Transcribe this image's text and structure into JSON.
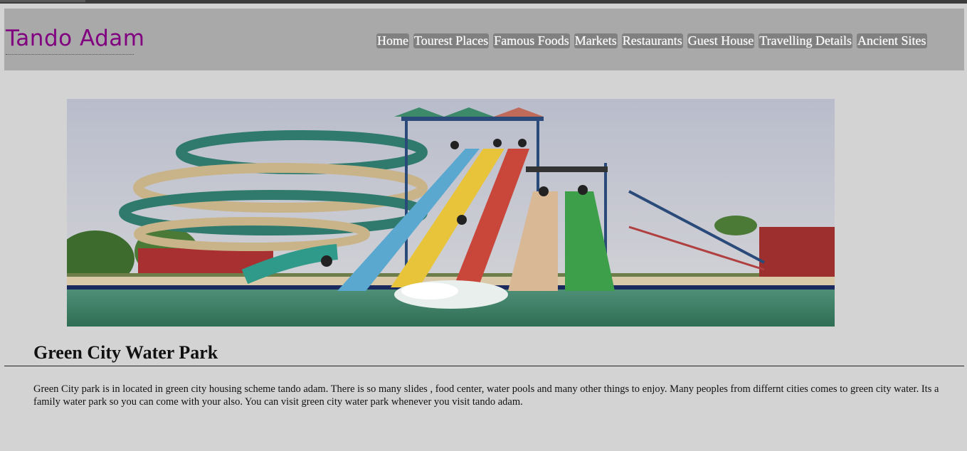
{
  "site": {
    "logo": "Tando Adam"
  },
  "nav": [
    {
      "label": "Home"
    },
    {
      "label": "Tourest Places"
    },
    {
      "label": "Famous Foods"
    },
    {
      "label": "Markets"
    },
    {
      "label": "Restaurants"
    },
    {
      "label": "Guest House"
    },
    {
      "label": "Travelling Details"
    },
    {
      "label": "Ancient Sites"
    }
  ],
  "article": {
    "title": "Green City Water Park",
    "body": "Green City park is in located in green city housing scheme tando adam. There is so many slides , food center, water pools and many other things to enjoy. Many peoples from differnt cities comes to green city water. Its a family water park so you can come with your also. You can visit green city water park whenever you visit tando adam."
  },
  "colors": {
    "background": "#d3d3d3",
    "header": "#a9a9a9",
    "logo": "#800080",
    "nav_bg": "#808080"
  }
}
